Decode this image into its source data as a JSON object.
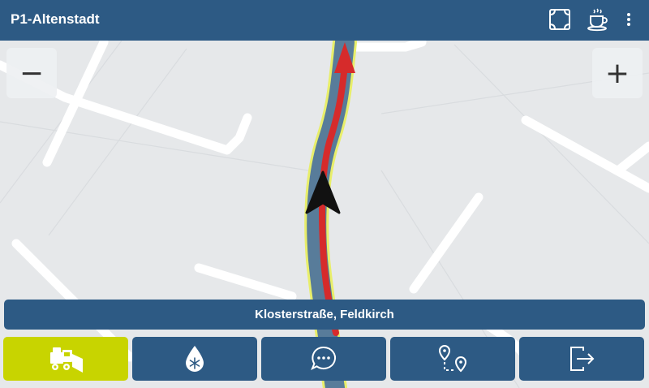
{
  "header": {
    "title": "P1-Altenstadt"
  },
  "icons": {
    "fullscreen": "fullscreen-icon",
    "break": "coffee-cup-icon",
    "menu": "more-vert-icon"
  },
  "map": {
    "zoom_out_label": "−",
    "zoom_in_label": "+"
  },
  "street": {
    "label": "Klosterstraße, Feldkirch"
  },
  "bottom_buttons": [
    {
      "icon": "snowplow-truck-icon",
      "active": true
    },
    {
      "icon": "salt-drop-snowflake-icon",
      "active": false
    },
    {
      "icon": "chat-bubble-icon",
      "active": false
    },
    {
      "icon": "route-waypoints-icon",
      "active": false
    },
    {
      "icon": "exit-icon",
      "active": false
    }
  ],
  "colors": {
    "brand_blue": "#2d5a84",
    "active_green": "#c8d400",
    "route_red": "#d62b2b",
    "route_track_blue": "#587c9a",
    "map_bg": "#e6e8ea"
  }
}
